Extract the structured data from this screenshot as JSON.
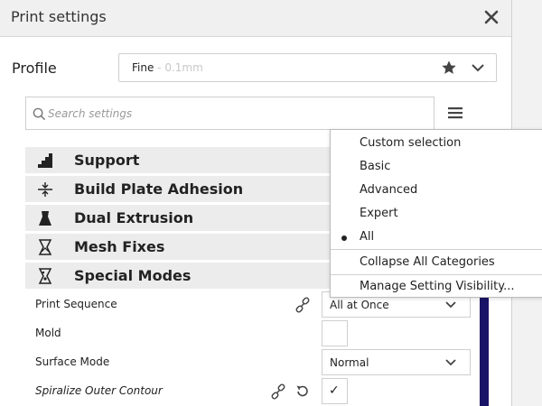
{
  "window": {
    "title": "Print settings"
  },
  "profile": {
    "label": "Profile",
    "name": "Fine",
    "sub": " - 0.1mm"
  },
  "search": {
    "placeholder": "Search settings"
  },
  "categories": [
    {
      "label": "Support",
      "icon": "support-icon"
    },
    {
      "label": "Build Plate Adhesion",
      "icon": "adhesion-icon"
    },
    {
      "label": "Dual Extrusion",
      "icon": "dual-extrusion-icon"
    },
    {
      "label": "Mesh Fixes",
      "icon": "mesh-fixes-icon"
    },
    {
      "label": "Special Modes",
      "icon": "special-modes-icon"
    }
  ],
  "settings": [
    {
      "label": "Print Sequence",
      "value": "All at Once",
      "control": "select"
    },
    {
      "label": "Mold",
      "control": "checkbox",
      "checked": false
    },
    {
      "label": "Surface Mode",
      "value": "Normal",
      "control": "select"
    },
    {
      "label": "Spiralize Outer Contour",
      "control": "checkbox",
      "checked": true,
      "check_mark": "✓"
    }
  ],
  "visibility_menu": {
    "items": [
      {
        "label": "Custom selection",
        "selected": false
      },
      {
        "label": "Basic",
        "selected": false
      },
      {
        "label": "Advanced",
        "selected": false
      },
      {
        "label": "Expert",
        "selected": false
      },
      {
        "label": "All",
        "selected": true
      }
    ],
    "collapse_label": "Collapse All Categories",
    "manage_label": "Manage Setting Visibility..."
  },
  "colors": {
    "accent": "#1a1466"
  }
}
